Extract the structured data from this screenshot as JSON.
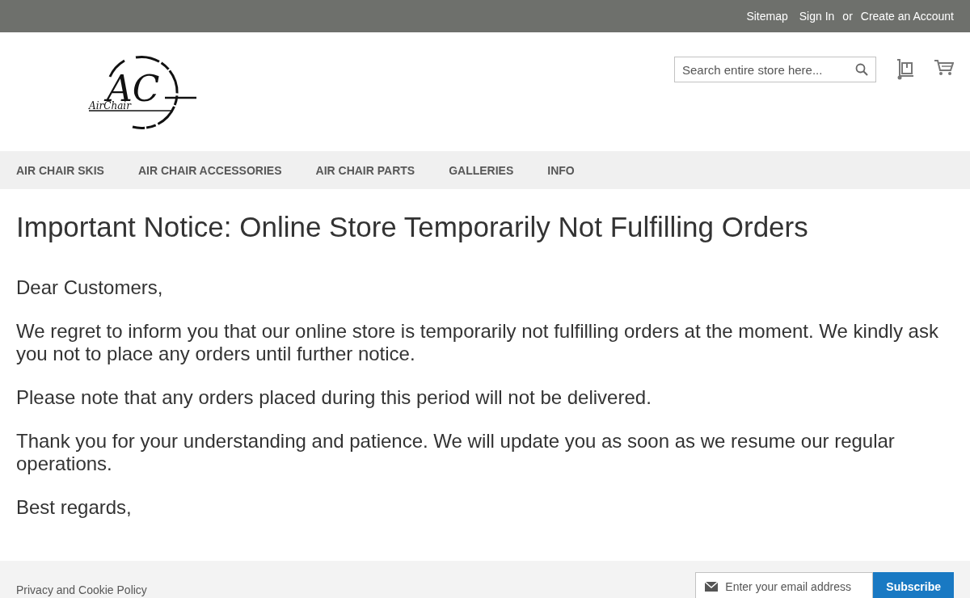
{
  "top_links": [
    {
      "label": "Sitemap",
      "kind": "link"
    },
    {
      "label": "Sign In",
      "kind": "link"
    },
    {
      "label": "or",
      "kind": "text"
    },
    {
      "label": "Create an Account",
      "kind": "link"
    }
  ],
  "logo": {
    "mark": "AC",
    "name": "AirChair"
  },
  "search": {
    "placeholder": "Search entire store here..."
  },
  "nav": [
    {
      "label": "AIR CHAIR SKIS"
    },
    {
      "label": "AIR CHAIR ACCESSORIES"
    },
    {
      "label": "AIR CHAIR PARTS"
    },
    {
      "label": "GALLERIES"
    },
    {
      "label": "INFO"
    }
  ],
  "page_title": "Important Notice: Online Store Temporarily Not Fulfilling Orders",
  "paragraphs": [
    "Dear Customers,",
    "We regret to inform you that our online store is temporarily not fulfilling orders at the moment. We kindly ask you not to place any orders until further notice.",
    "Please note that any orders placed during this period will not be delivered.",
    "Thank you for your understanding and patience. We will update you as soon as we resume our regular operations.",
    "Best regards,"
  ],
  "footer": {
    "link": "Privacy and Cookie Policy",
    "newsletter_placeholder": "Enter your email address",
    "subscribe": "Subscribe"
  }
}
